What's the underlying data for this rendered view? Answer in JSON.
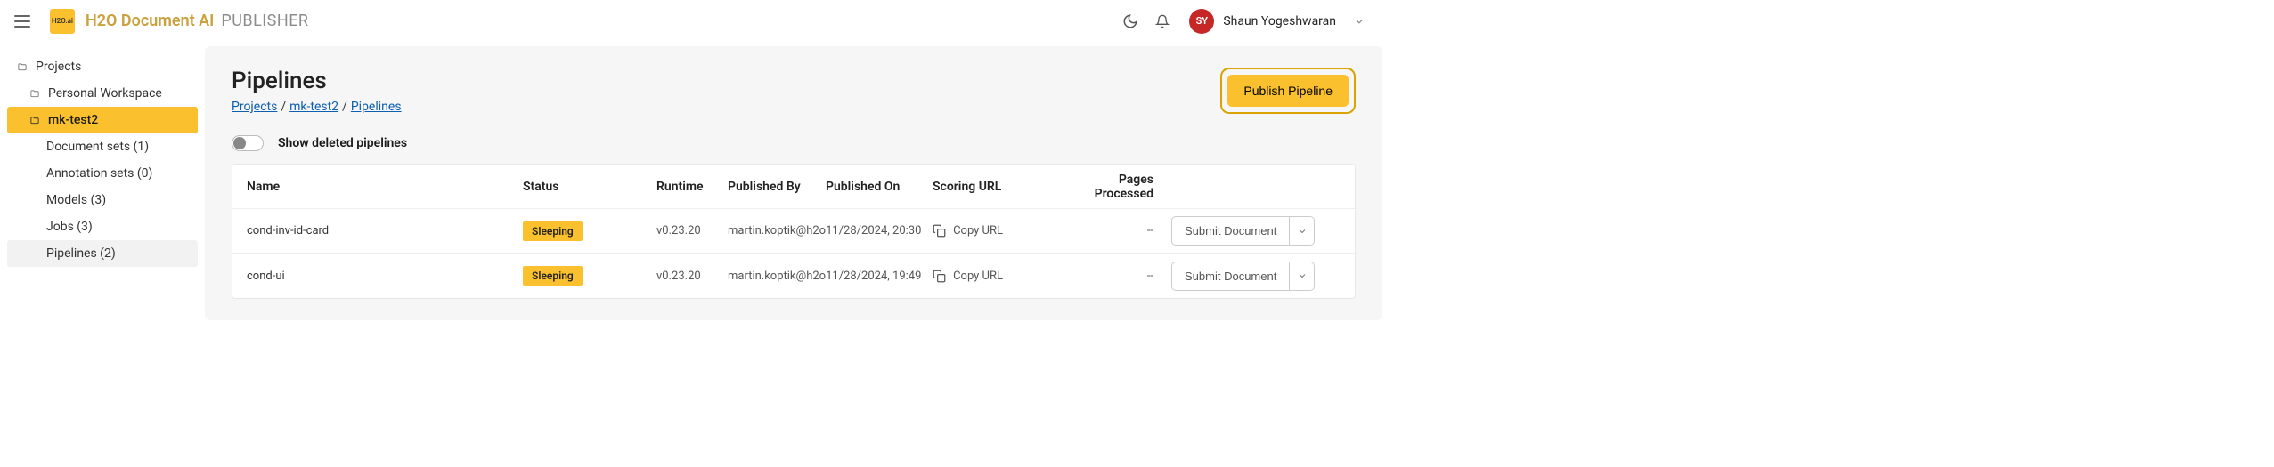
{
  "header": {
    "logo_text": "H2O.ai",
    "app_title": "H2O Document AI",
    "app_subtitle": "PUBLISHER",
    "user_initials": "SY",
    "user_name": "Shaun Yogeshwaran"
  },
  "sidebar": {
    "root": "Projects",
    "workspace": "Personal Workspace",
    "active_project": "mk-test2",
    "items": [
      {
        "label": "Document sets (1)"
      },
      {
        "label": "Annotation sets (0)"
      },
      {
        "label": "Models (3)"
      },
      {
        "label": "Jobs (3)"
      },
      {
        "label": "Pipelines (2)"
      }
    ]
  },
  "main": {
    "title": "Pipelines",
    "breadcrumb": {
      "a": "Projects",
      "b": "mk-test2",
      "c": "Pipelines"
    },
    "publish_label": "Publish Pipeline",
    "toggle_label": "Show deleted pipelines",
    "columns": {
      "name": "Name",
      "status": "Status",
      "runtime": "Runtime",
      "published_by": "Published By",
      "published_on": "Published On",
      "scoring_url": "Scoring URL",
      "pages": "Pages Processed"
    },
    "copy_label": "Copy URL",
    "submit_label": "Submit Document",
    "rows": [
      {
        "name": "cond-inv-id-card",
        "status": "Sleeping",
        "runtime": "v0.23.20",
        "published_by": "martin.koptik@h2o",
        "published_on": "11/28/2024, 20:30",
        "pages": "--"
      },
      {
        "name": "cond-ui",
        "status": "Sleeping",
        "runtime": "v0.23.20",
        "published_by": "martin.koptik@h2o",
        "published_on": "11/28/2024, 19:49",
        "pages": "--"
      }
    ]
  }
}
